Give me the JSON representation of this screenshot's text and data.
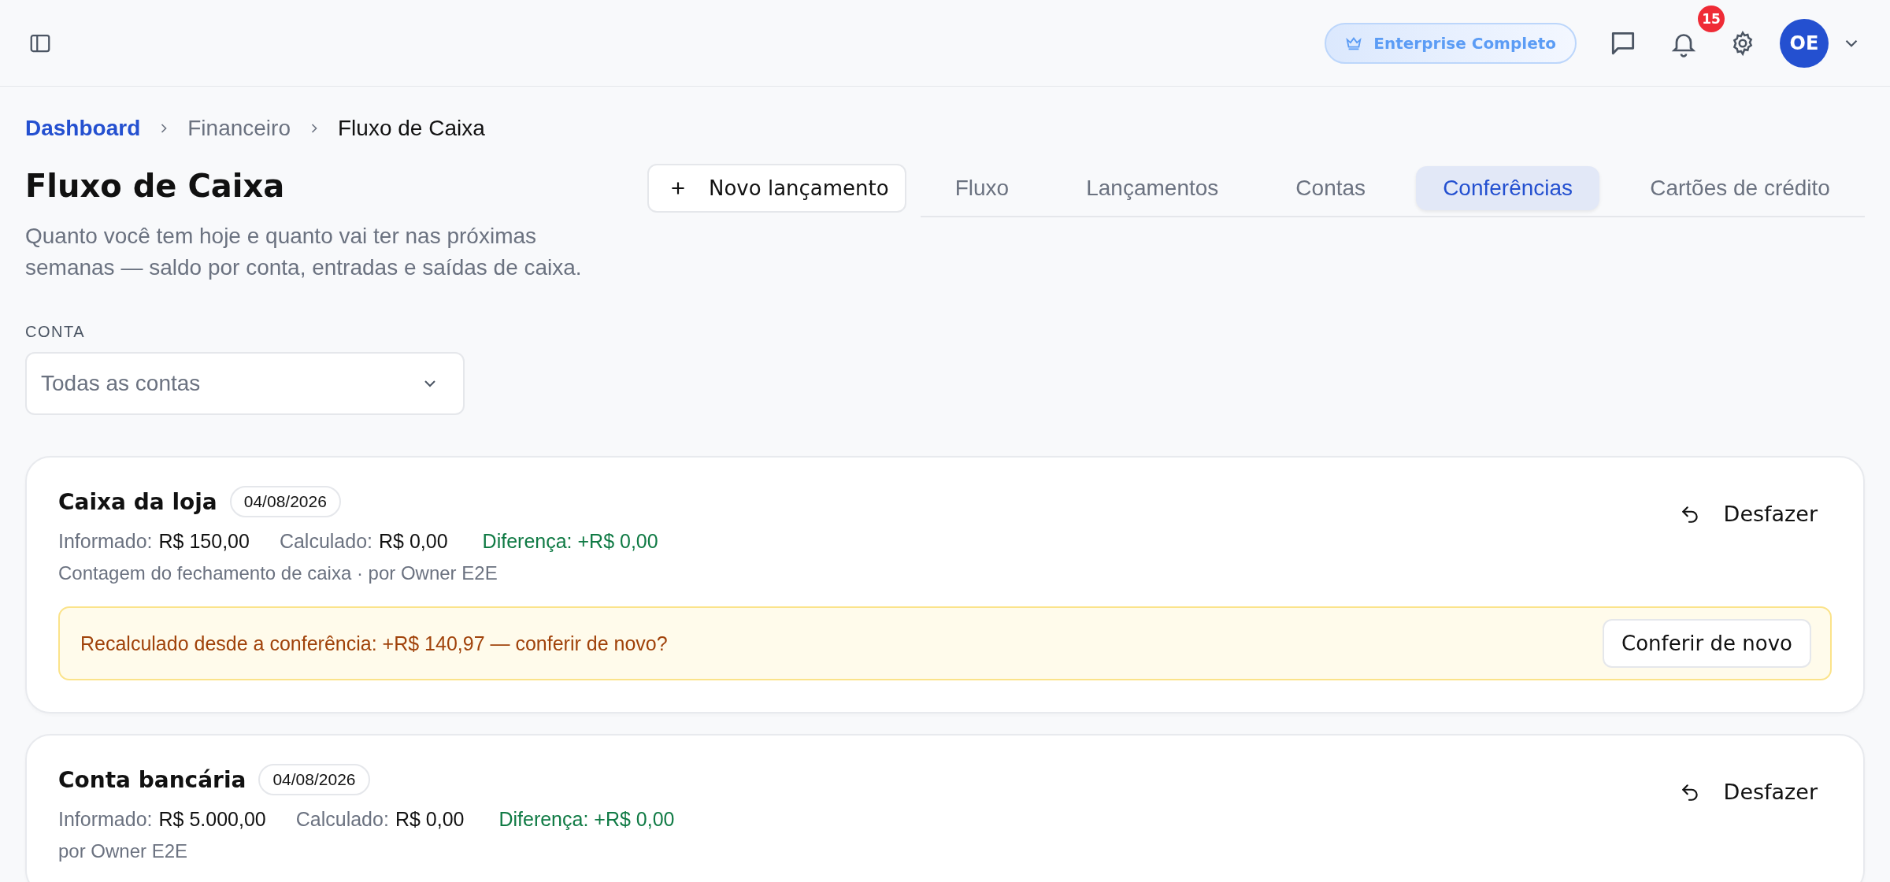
{
  "topbar": {
    "plan_badge": "Enterprise Completo",
    "notification_count": "15",
    "avatar_initials": "OE"
  },
  "breadcrumb": [
    {
      "label": "Dashboard",
      "kind": "link"
    },
    {
      "label": "Financeiro",
      "kind": "muted"
    },
    {
      "label": "Fluxo de Caixa",
      "kind": "current"
    }
  ],
  "page": {
    "title": "Fluxo de Caixa",
    "description": "Quanto você tem hoje e quanto vai ter nas próximas semanas — saldo por conta, entradas e saídas de caixa.",
    "new_button": "Novo lançamento"
  },
  "tabs": [
    {
      "label": "Fluxo",
      "selected": false
    },
    {
      "label": "Lançamentos",
      "selected": false
    },
    {
      "label": "Contas",
      "selected": false
    },
    {
      "label": "Conferências",
      "selected": true
    },
    {
      "label": "Cartões de crédito",
      "selected": false
    }
  ],
  "filter": {
    "label": "CONTA",
    "value": "Todas as contas"
  },
  "cards": [
    {
      "name": "Caixa da loja",
      "date": "04/08/2026",
      "informed_label": "Informado:",
      "informed_value": "R$ 150,00",
      "calculated_label": "Calculado:",
      "calculated_value": "R$ 0,00",
      "difference": "Diferença: +R$ 0,00",
      "note": "Contagem do fechamento de caixa · por Owner E2E",
      "undo_button": "Desfazer",
      "warning": {
        "text": "Recalculado desde a conferência: +R$ 140,97 — conferir de novo?",
        "button": "Conferir de novo"
      }
    },
    {
      "name": "Conta bancária",
      "date": "04/08/2026",
      "informed_label": "Informado:",
      "informed_value": "R$ 5.000,00",
      "calculated_label": "Calculado:",
      "calculated_value": "R$ 0,00",
      "difference": "Diferença: +R$ 0,00",
      "note": "por Owner E2E",
      "undo_button": "Desfazer"
    }
  ]
}
